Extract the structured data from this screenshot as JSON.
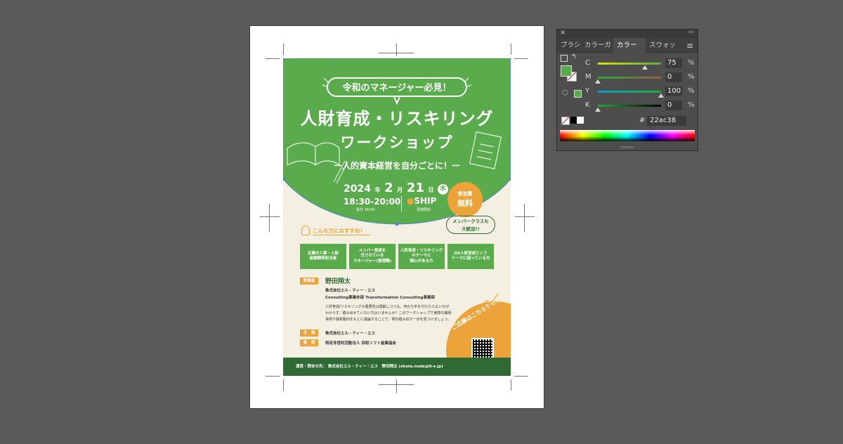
{
  "flyer": {
    "pill_text": "令和のマネージャー必見！",
    "title1": "人財育成・リスキリング",
    "title2": "ワークショップ",
    "subtitle": "ー人的資本経営を自分ごとに！ー",
    "year": "2024",
    "year_unit": "年",
    "month": "2",
    "month_unit": "月",
    "day": "21",
    "day_unit": "日",
    "weekday": "水",
    "time": "18:30-20:00",
    "reception": "受付 18:00-",
    "venue": "SHIP",
    "venue_note": "現地限定",
    "fee_label": "参加費",
    "fee_value": "無料",
    "recommend_heading": "こんな方におすすめ！",
    "member_bubble_1": "メンバークラスも",
    "member_bubble_2": "大歓迎!!",
    "recommend_boxes": [
      "企業の人事・人財\n組織開発担当者",
      "メンバー育成を\n任されている\nマネージャー(管理職)",
      "人財育成・リスキリング\nのテーマに\n関心がある方",
      "DX人財育成という\nテーマに困っている方"
    ],
    "speaker_tag": "登壇者",
    "speaker_name": "野田翔太",
    "speaker_org1": "株式会社エル・ティー・エス",
    "speaker_org2": "Consulting事業本部 Transformation Consulting事業部",
    "desc1": "人財育成/リスキリングの重要性は理解しつつも、何から手を付けたらよいかが",
    "desc2": "わからず、踏み出せていない方はいませんか？このワークショップで実際の課題",
    "desc3": "事例や最新動向をもとに議論することで、明日踏み出す一歩を見つけましょう。",
    "host_tag": "主　催",
    "host": "株式会社エル・ティー・エス",
    "support_tag": "後　援",
    "support": "特定非営利活動法人 浜松ソフト産業協会",
    "apply": "ご応募はこちらから！",
    "footer": "運営・問合せ先：  株式会社エル・ティー・エス　野田翔太 (shota.noda@lt-s.jp)"
  },
  "color_panel": {
    "tabs": [
      "ブラシ",
      "カラーガ",
      "カラー",
      "スウォッ"
    ],
    "active_tab": "カラー",
    "sliders": [
      {
        "label": "C",
        "value": "75",
        "fraction": 0.75,
        "color": "#00aeef"
      },
      {
        "label": "M",
        "value": "0",
        "fraction": 0.0,
        "color": "#ec008c"
      },
      {
        "label": "Y",
        "value": "100",
        "fraction": 1.0,
        "color": "#fff200"
      },
      {
        "label": "K",
        "value": "0",
        "fraction": 0.0,
        "color": "#000000"
      }
    ],
    "percent": "%",
    "hash": "#",
    "hex": "22ac38",
    "fill_color": "#22ac38"
  },
  "colors": {
    "green": "#5aab4c",
    "orange": "#eba33a",
    "dark_green": "#2f6a34"
  }
}
